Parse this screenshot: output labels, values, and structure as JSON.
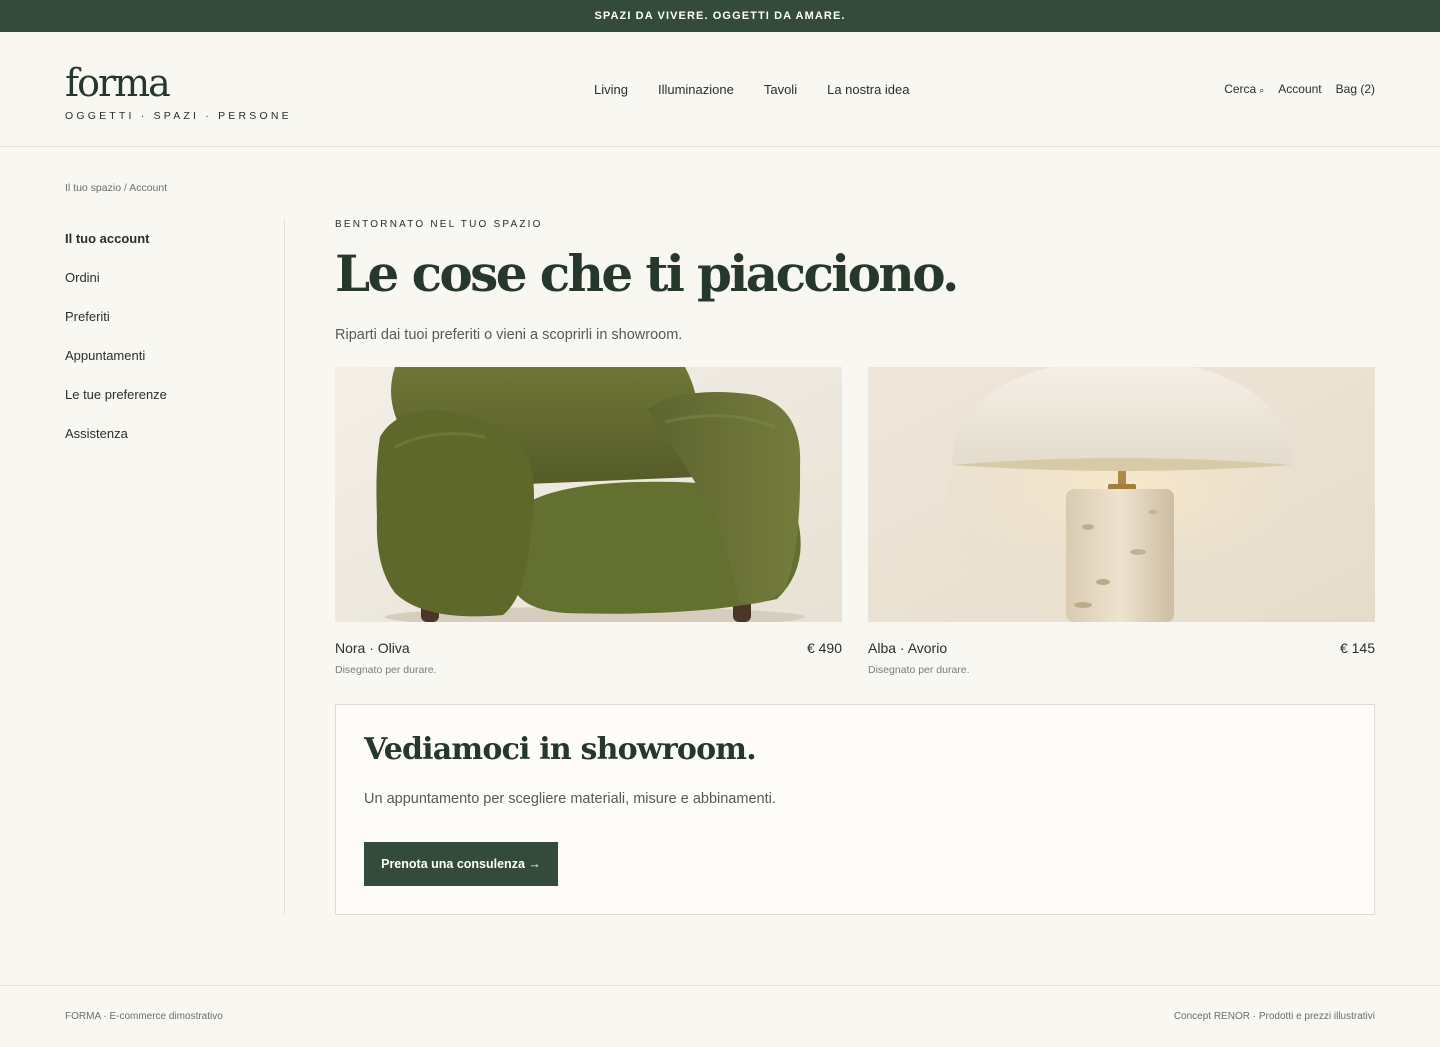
{
  "announcement": "SPAZI DA VIVERE. OGGETTI DA AMARE.",
  "brand": {
    "name": "forma",
    "tagline": "OGGETTI · SPAZI · PERSONE"
  },
  "nav": [
    {
      "label": "Living"
    },
    {
      "label": "Illuminazione"
    },
    {
      "label": "Tavoli"
    },
    {
      "label": "La nostra idea"
    }
  ],
  "utility": {
    "search": "Cerca",
    "search_icon": "⌕",
    "account": "Account",
    "bag": "Bag (2)"
  },
  "breadcrumb": "Il tuo spazio / Account",
  "sidebar": [
    {
      "label": "Il tuo account"
    },
    {
      "label": "Ordini"
    },
    {
      "label": "Preferiti"
    },
    {
      "label": "Appuntamenti"
    },
    {
      "label": "Le tue preferenze"
    },
    {
      "label": "Assistenza"
    }
  ],
  "hero": {
    "eyebrow": "BENTORNATO NEL TUO SPAZIO",
    "title": "Le cose che ti piacciono.",
    "lead": "Riparti dai tuoi preferiti o vieni a scoprirli in showroom."
  },
  "products": [
    {
      "name": "Nora · Oliva",
      "price": "€ 490",
      "subtitle": "Disegnato per durare."
    },
    {
      "name": "Alba · Avorio",
      "price": "€ 145",
      "subtitle": "Disegnato per durare."
    }
  ],
  "cta": {
    "title": "Vediamoci in showroom.",
    "text": "Un appuntamento per scegliere materiali, misure e abbinamenti.",
    "button": "Prenota una consulenza →"
  },
  "footer": {
    "left": "FORMA · E-commerce dimostrativo",
    "right": "Concept RENOR · Prodotti e prezzi illustrativi"
  },
  "colors": {
    "brand_green": "#344a3b",
    "background": "#f8f7f2",
    "heading": "#26372c"
  }
}
